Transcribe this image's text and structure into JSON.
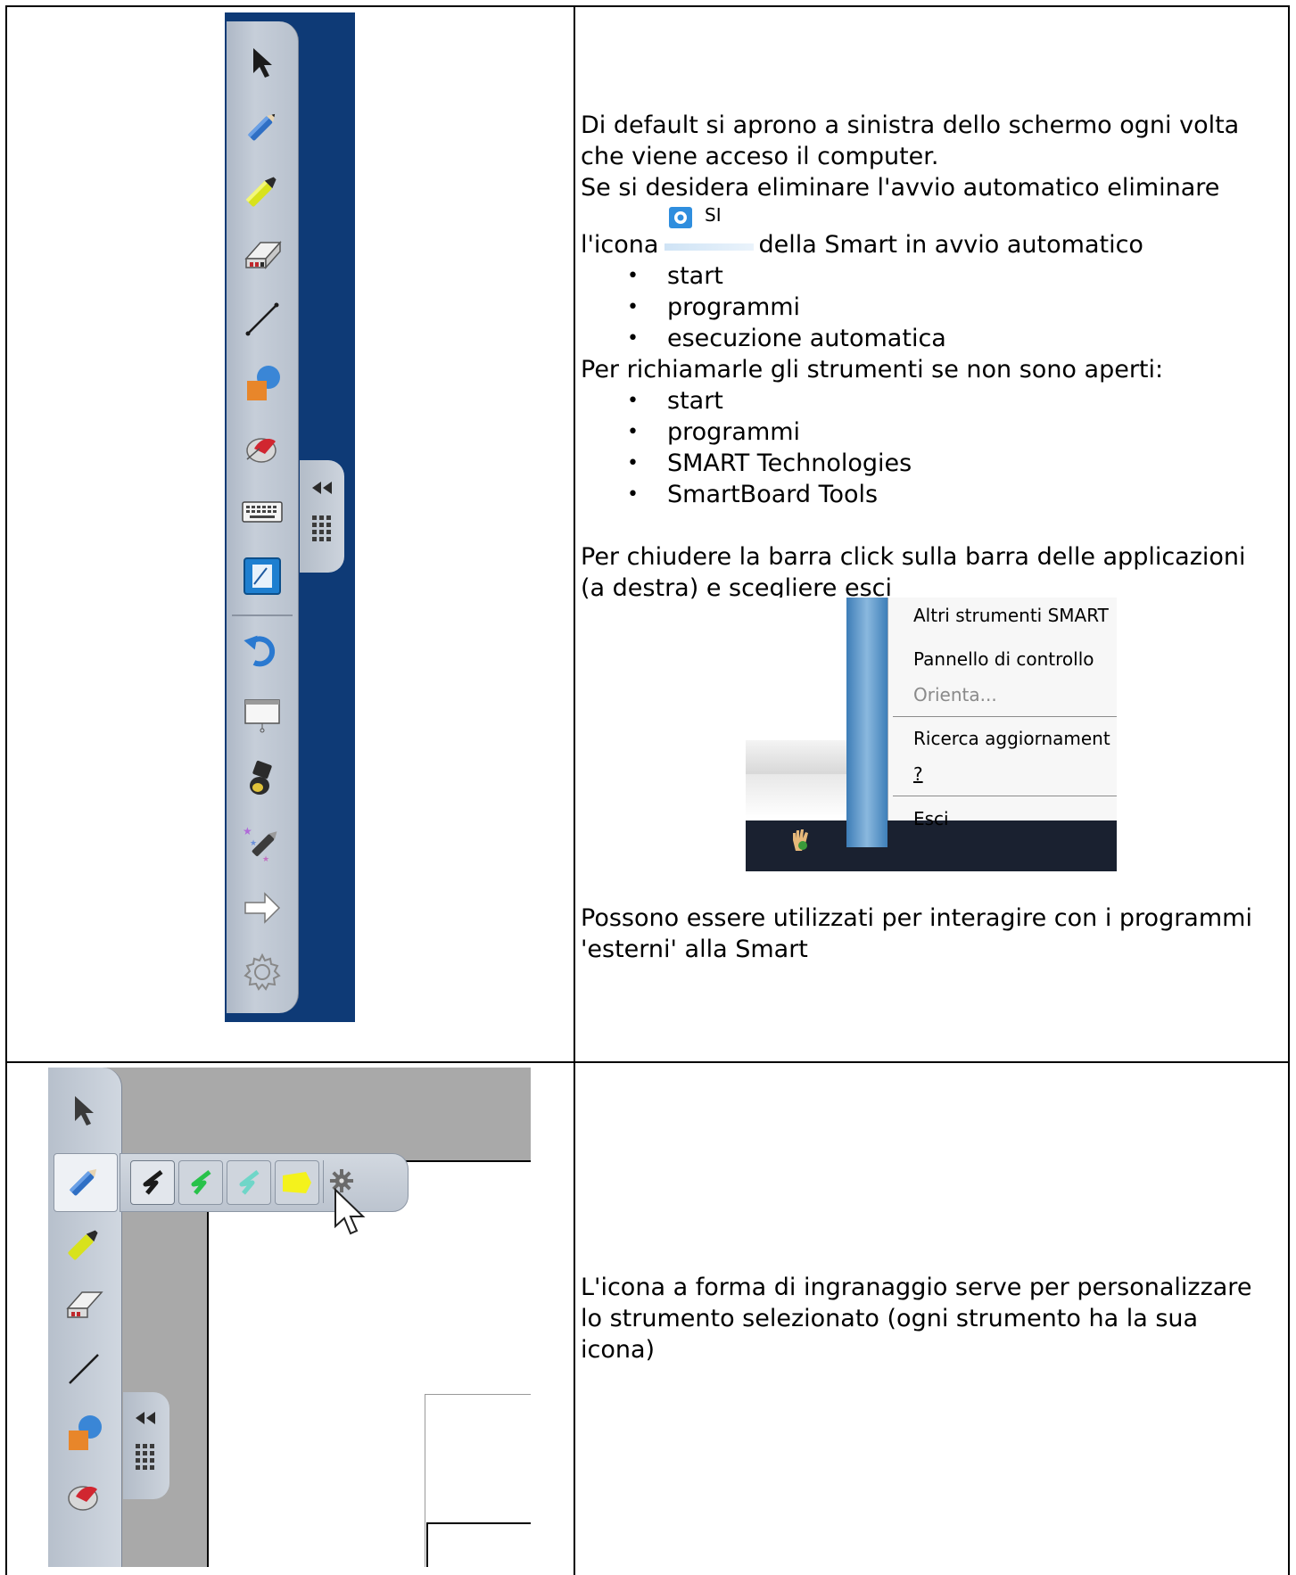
{
  "row1": {
    "intro": [
      "Di default si aprono a sinistra dello schermo ogni volta",
      "che viene acceso il computer.",
      "Se si desidera eliminare l'avvio automatico eliminare"
    ],
    "icon_line_prefix": "l'icona",
    "icon_caption": "SI",
    "icon_line_suffix": "della Smart in avvio automatico",
    "list1": [
      "start",
      "programmi",
      "esecuzione automatica"
    ],
    "recall_text": "Per richiamarle gli strumenti se non sono aperti:",
    "list2": [
      "start",
      "programmi",
      "SMART Technologies",
      "SmartBoard Tools"
    ],
    "close_text": [
      "Per chiudere la barra click sulla barra delle applicazioni",
      "(a destra) e scegliere esci"
    ],
    "context_menu": {
      "items": [
        "Altri strumenti SMART",
        "Pannello di controllo",
        "Orienta...",
        "Ricerca aggiornament",
        "?",
        "Esci"
      ],
      "disabled_color": "#8a8a8a"
    },
    "external_text": [
      "Possono essere utilizzati per interagire con i programmi",
      "'esterni' alla Smart"
    ],
    "toolbar_icons": [
      "select-arrow-icon",
      "pen-icon",
      "highlighter-icon",
      "eraser-icon",
      "line-icon",
      "shapes-icon",
      "magic-pen-icon",
      "keyboard-icon",
      "notebook-icon",
      "undo-icon",
      "screen-shade-icon",
      "spotlight-icon",
      "creative-pen-icon",
      "next-arrow-icon",
      "settings-gear-icon"
    ]
  },
  "row2": {
    "description": [
      "L'icona a forma di ingranaggio serve per personalizzare",
      "lo strumento selezionato (ogni strumento ha la sua",
      "icona)"
    ]
  },
  "colors": {
    "toolbar_bg": "#0e3a76",
    "menu_strip": "#3d7db7",
    "canvas_gray": "#a9a9a9"
  }
}
